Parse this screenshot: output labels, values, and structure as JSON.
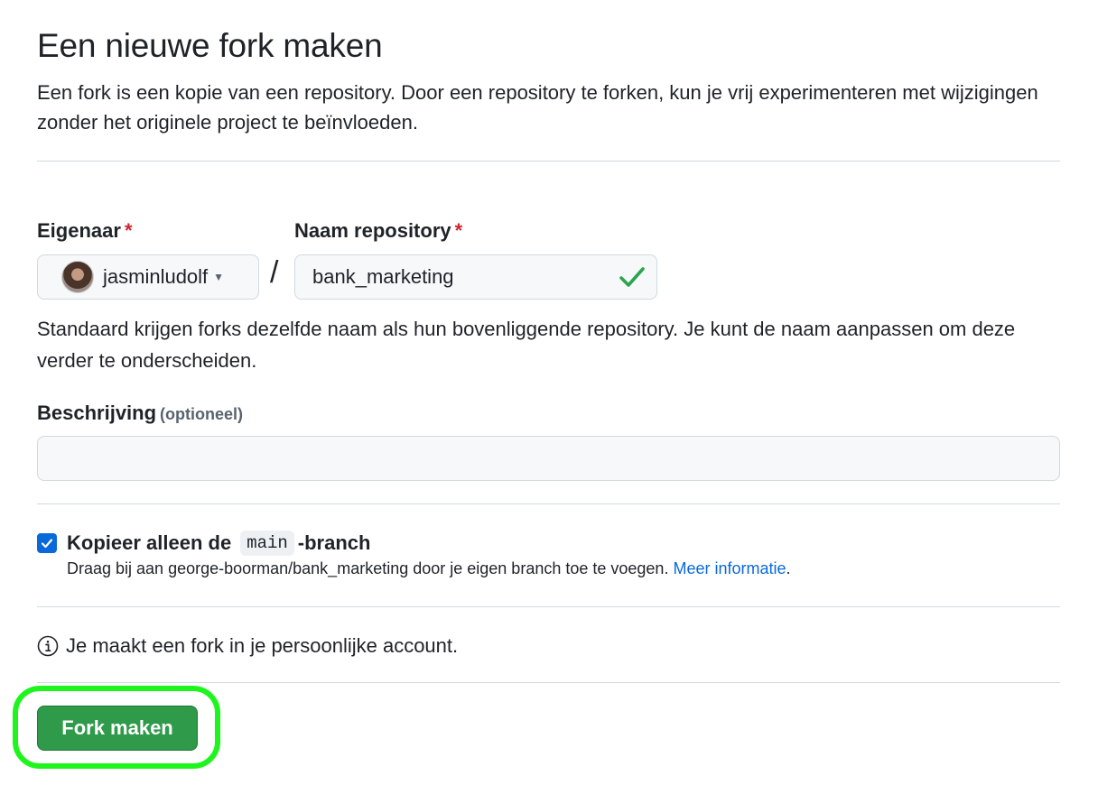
{
  "header": {
    "title": "Een nieuwe fork maken",
    "description": "Een fork is een kopie van een repository. Door een repository te forken, kun je vrij experimenteren met wijzigingen zonder het originele project te beïnvloeden."
  },
  "owner": {
    "label": "Eigenaar",
    "required_mark": "*",
    "selected": "jasminludolf",
    "avatar_icon": "user-avatar"
  },
  "separator": "/",
  "repository": {
    "label": "Naam repository",
    "required_mark": "*",
    "value": "bank_marketing",
    "valid_icon": "check-icon",
    "hint": "Standaard krijgen forks dezelfde naam als hun bovenliggende repository. Je kunt de naam aanpassen om deze verder te onderscheiden."
  },
  "description": {
    "label": "Beschrijving",
    "optional_note": "(optioneel)",
    "value": ""
  },
  "copy_branch": {
    "checked": true,
    "label_prefix": "Kopieer alleen de",
    "branch": "main",
    "label_suffix": "-branch",
    "help_text": "Draag bij aan george-boorman/bank_marketing door je eigen branch toe te voegen.",
    "help_link": "Meer informatie",
    "help_end": "."
  },
  "notice": {
    "icon": "info-icon",
    "text": "Je maakt een fork in je persoonlijke account."
  },
  "submit": {
    "label": "Fork maken"
  },
  "colors": {
    "primary_button": "#2e9a4a",
    "link": "#0969da",
    "required": "#d1242f",
    "highlight": "#1df51d",
    "checkbox": "#0969da"
  }
}
